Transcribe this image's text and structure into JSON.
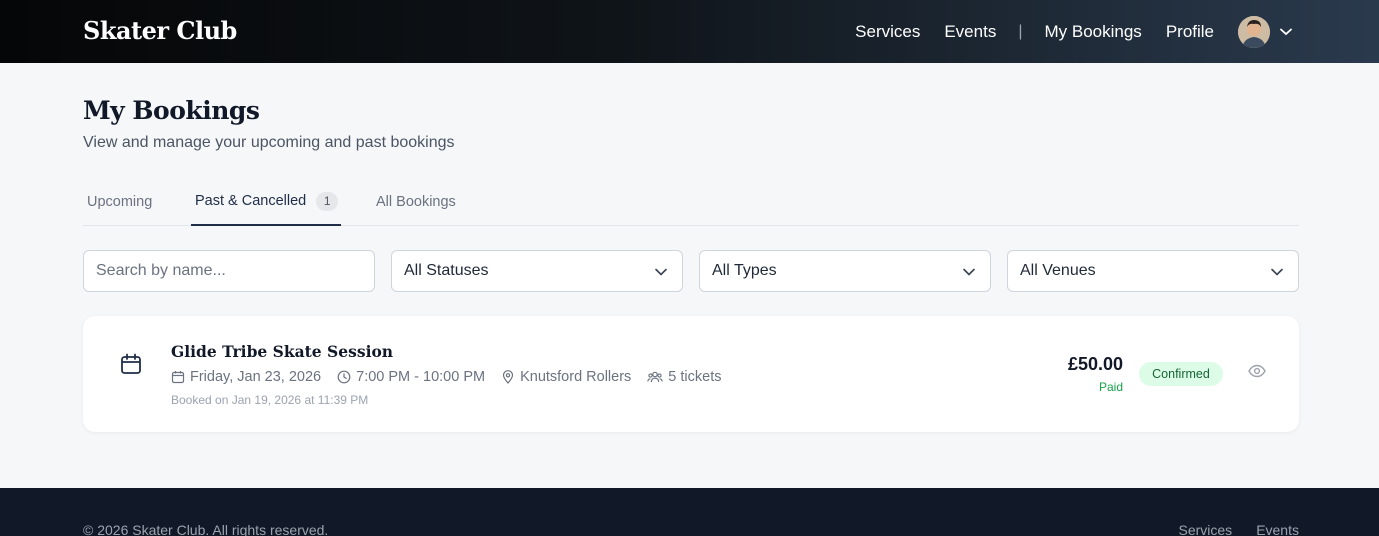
{
  "header": {
    "brand": "Skater Club",
    "nav": [
      "Services",
      "Events",
      "My Bookings",
      "Profile"
    ],
    "separator": "|",
    "avatar_icon": "user-avatar",
    "chevron_icon": "chevron-down-icon"
  },
  "page": {
    "title": "My Bookings",
    "subtitle": "View and manage your upcoming and past bookings"
  },
  "tabs": [
    {
      "label": "Upcoming"
    },
    {
      "label": "Past & Cancelled",
      "count": "1",
      "active": true
    },
    {
      "label": "All Bookings"
    }
  ],
  "filters": {
    "search_placeholder": "Search by name...",
    "status": "All Statuses",
    "type": "All Types",
    "venue": "All Venues"
  },
  "booking": {
    "title": "Glide Tribe Skate Session",
    "date": "Friday, Jan 23, 2026",
    "time": "7:00 PM - 10:00 PM",
    "venue": "Knutsford Rollers",
    "tickets": "5 tickets",
    "booked_on": "Booked on Jan 19, 2026 at 11:39 PM",
    "price": "£50.00",
    "payment_status": "Paid",
    "status": "Confirmed"
  },
  "footer": {
    "copyright": "© 2026 Skater Club. All rights reserved.",
    "links": [
      "Services",
      "Events"
    ]
  },
  "colors": {
    "accent": "#1f2d46",
    "confirmed_bg": "#dcfce7",
    "paid_text": "#16a34a",
    "footer_bg": "#111827"
  }
}
